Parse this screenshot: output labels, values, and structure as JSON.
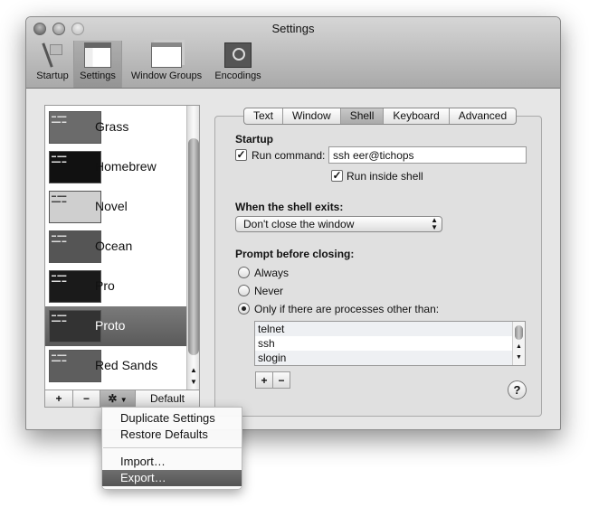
{
  "window": {
    "title": "Settings"
  },
  "toolbar": [
    {
      "label": "Startup",
      "icon": "flag-icon"
    },
    {
      "label": "Settings",
      "icon": "settings-window-icon",
      "selected": true
    },
    {
      "label": "Window Groups",
      "icon": "window-groups-icon"
    },
    {
      "label": "Encodings",
      "icon": "un-flag-icon"
    }
  ],
  "profiles": [
    {
      "name": "Grass",
      "bg": "#6b6b6b"
    },
    {
      "name": "Homebrew",
      "bg": "#111111"
    },
    {
      "name": "Novel",
      "bg": "#cfcfcf"
    },
    {
      "name": "Ocean",
      "bg": "#555555"
    },
    {
      "name": "Pro",
      "bg": "#1a1a1a"
    },
    {
      "name": "Proto",
      "bg": "#333333",
      "selected": true
    },
    {
      "name": "Red Sands",
      "bg": "#5e5e5e"
    }
  ],
  "list_buttons": {
    "add": "+",
    "remove": "−",
    "default": "Default"
  },
  "tabs": [
    {
      "label": "Text"
    },
    {
      "label": "Window"
    },
    {
      "label": "Shell",
      "selected": true
    },
    {
      "label": "Keyboard"
    },
    {
      "label": "Advanced"
    }
  ],
  "shell": {
    "startup_heading": "Startup",
    "run_command_label": "Run command:",
    "run_command_checked": true,
    "run_command_value": "ssh eer@tichops",
    "run_inside_shell_label": "Run inside shell",
    "run_inside_shell_checked": true,
    "exit_heading": "When the shell exits:",
    "exit_value": "Don't close the window",
    "prompt_heading": "Prompt before closing:",
    "options": [
      {
        "label": "Always",
        "selected": false
      },
      {
        "label": "Never",
        "selected": false
      },
      {
        "label": "Only if there are processes other than:",
        "selected": true
      }
    ],
    "processes": [
      "telnet",
      "ssh",
      "slogin"
    ],
    "add": "+",
    "remove": "−",
    "help": "?"
  },
  "menu": [
    {
      "label": "Duplicate Settings"
    },
    {
      "label": "Restore Defaults"
    },
    {
      "label": "Import…"
    },
    {
      "label": "Export…",
      "highlighted": true
    }
  ]
}
